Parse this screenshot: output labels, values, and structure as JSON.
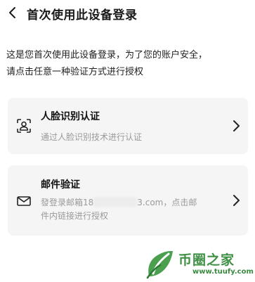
{
  "header": {
    "back_icon": "chevron-left-icon",
    "title": "首次使用此设备登录"
  },
  "description": {
    "line1": "这是您首次使用此设备登录，为了您的账户安全，",
    "line2": "请点击任意一种验证方式进行授权"
  },
  "options": {
    "face": {
      "icon": "face-scan-icon",
      "title": "人脸识别认证",
      "subtitle": "通过人脸识别技术进行认证",
      "arrow_icon": "chevron-right-icon"
    },
    "email": {
      "icon": "envelope-icon",
      "title": "邮件验证",
      "subtitle_prefix": "發登录邮箱18",
      "subtitle_suffix": "3.com，点击邮",
      "subtitle_line2": "件内链接进行授权",
      "arrow_icon": "chevron-right-icon"
    }
  },
  "watermark": {
    "brand": "币圈之家",
    "url": "www.tuufy.com",
    "brand_color": "#3f8f45"
  }
}
